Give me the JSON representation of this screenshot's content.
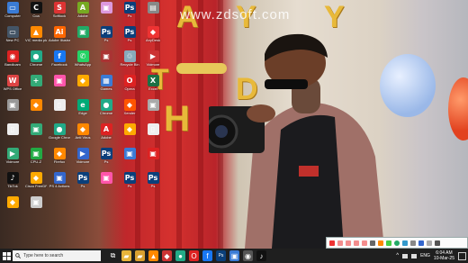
{
  "watermark": "www.zdsoft.com",
  "desktop_icons": [
    {
      "label": "Computer",
      "color": "#3a7bd5",
      "glyph": "▭"
    },
    {
      "label": "Coa",
      "color": "#111",
      "glyph": "C"
    },
    {
      "label": "Softlock",
      "color": "#d33",
      "glyph": "S"
    },
    {
      "label": "Adobe",
      "color": "#7a2",
      "glyph": "A"
    },
    {
      "label": "",
      "color": "#d9d",
      "glyph": "▣"
    },
    {
      "label": "Ps",
      "color": "#0b3f7a",
      "glyph": "Ps"
    },
    {
      "label": "",
      "color": "#888",
      "glyph": "▤"
    },
    {
      "label": "New PC",
      "color": "#456",
      "glyph": "▭"
    },
    {
      "label": "VIC media player",
      "color": "#f80",
      "glyph": "▲"
    },
    {
      "label": "Adobe Illustrator",
      "color": "#f60",
      "glyph": "Ai"
    },
    {
      "label": "",
      "color": "#2a6",
      "glyph": "▣"
    },
    {
      "label": "Ps",
      "color": "#0b3f7a",
      "glyph": "Ps"
    },
    {
      "label": "Ps",
      "color": "#0b3f7a",
      "glyph": "Ps"
    },
    {
      "label": "AnyDesk",
      "color": "#e33",
      "glyph": "◆"
    },
    {
      "label": "Bandicam",
      "color": "#d22",
      "glyph": "◉"
    },
    {
      "label": "Chrome",
      "color": "#2a8",
      "glyph": "●"
    },
    {
      "label": "Facebook",
      "color": "#1877f2",
      "glyph": "f"
    },
    {
      "label": "WhatsApp",
      "color": "#25d366",
      "glyph": "✆"
    },
    {
      "label": "",
      "color": "#a33",
      "glyph": "▣"
    },
    {
      "label": "Recycle Bin",
      "color": "#8ab",
      "glyph": "♲"
    },
    {
      "label": "Vidmore",
      "color": "#c33",
      "glyph": "▶"
    },
    {
      "label": "WPS Office",
      "color": "#d44",
      "glyph": "W"
    },
    {
      "label": "",
      "color": "#3a7",
      "glyph": "+"
    },
    {
      "label": "",
      "color": "#f5a",
      "glyph": "▣"
    },
    {
      "label": "",
      "color": "#fa0",
      "glyph": "◆"
    },
    {
      "label": "Games",
      "color": "#3a7bd5",
      "glyph": "▦"
    },
    {
      "label": "Opera",
      "color": "#d22",
      "glyph": "O"
    },
    {
      "label": "Excel",
      "color": "#1d7044",
      "glyph": "X"
    },
    {
      "label": "",
      "color": "#999",
      "glyph": "▣"
    },
    {
      "label": "",
      "color": "#f80",
      "glyph": "◆"
    },
    {
      "label": "",
      "color": "#eee",
      "glyph": "▯"
    },
    {
      "label": "Edge",
      "color": "#0a7",
      "glyph": "e"
    },
    {
      "label": "Chrome",
      "color": "#2a8",
      "glyph": "●"
    },
    {
      "label": "Xender",
      "color": "#f50",
      "glyph": "◆"
    },
    {
      "label": "",
      "color": "#aaa",
      "glyph": "▣"
    },
    {
      "label": "",
      "color": "#eee",
      "glyph": "▯"
    },
    {
      "label": "",
      "color": "#3a7",
      "glyph": "▣"
    },
    {
      "label": "Google Chrome",
      "color": "#2a8",
      "glyph": "●"
    },
    {
      "label": "Anti Virus",
      "color": "#f80",
      "glyph": "◆"
    },
    {
      "label": "Adobe",
      "color": "#d22",
      "glyph": "A"
    },
    {
      "label": "",
      "color": "#fa0",
      "glyph": "◆"
    },
    {
      "label": "",
      "color": "#eee",
      "glyph": "▯"
    },
    {
      "label": "Vidmore",
      "color": "#3a7",
      "glyph": "▶"
    },
    {
      "label": "CPU-Z",
      "color": "#2a4",
      "glyph": "▣"
    },
    {
      "label": "Firefox",
      "color": "#f80",
      "glyph": "◆"
    },
    {
      "label": "Vidmore",
      "color": "#36c",
      "glyph": "▶"
    },
    {
      "label": "Ps",
      "color": "#0b3f7a",
      "glyph": "Ps"
    },
    {
      "label": "",
      "color": "#3a7bd5",
      "glyph": "▣"
    },
    {
      "label": "",
      "color": "#d22",
      "glyph": "▣"
    },
    {
      "label": "TikTok",
      "color": "#111",
      "glyph": "♪"
    },
    {
      "label": "Cisco FreeDPC",
      "color": "#fa0",
      "glyph": "◆"
    },
    {
      "label": "PS 4 Actions",
      "color": "#36c",
      "glyph": "▣"
    },
    {
      "label": "Ps",
      "color": "#0b3f7a",
      "glyph": "Ps"
    },
    {
      "label": "",
      "color": "#f5a",
      "glyph": "▣"
    },
    {
      "label": "Ps",
      "color": "#0b3f7a",
      "glyph": "Ps"
    },
    {
      "label": "Ps",
      "color": "#0b3f7a",
      "glyph": "Ps"
    },
    {
      "label": "",
      "color": "#fa0",
      "glyph": "◆"
    },
    {
      "label": "",
      "color": "#ccc",
      "glyph": "▣"
    }
  ],
  "taskbar": {
    "search_placeholder": "Type here to search",
    "apps": [
      {
        "name": "task-view-icon",
        "glyph": "⧉",
        "color": "#1f1f1f"
      },
      {
        "name": "file-explorer-icon",
        "glyph": "▰",
        "color": "#e8b43a"
      },
      {
        "name": "folder-icon",
        "glyph": "▰",
        "color": "#d9a030"
      },
      {
        "name": "vlc-icon",
        "glyph": "▲",
        "color": "#f80"
      },
      {
        "name": "app-icon",
        "glyph": "◆",
        "color": "#c33"
      },
      {
        "name": "chrome-icon",
        "glyph": "●",
        "color": "#2a8"
      },
      {
        "name": "opera-icon",
        "glyph": "O",
        "color": "#d22"
      },
      {
        "name": "facebook-icon",
        "glyph": "f",
        "color": "#1877f2"
      },
      {
        "name": "photoshop-icon",
        "glyph": "Ps",
        "color": "#0b3f7a"
      },
      {
        "name": "app2-icon",
        "glyph": "▣",
        "color": "#3a7bd5"
      },
      {
        "name": "app3-icon",
        "glyph": "◉",
        "color": "#555"
      },
      {
        "name": "tiktok-icon",
        "glyph": "♪",
        "color": "#111"
      }
    ],
    "tray_lang": "ENG",
    "clock_time": "6:04 AM",
    "clock_date": "10-Mar-25"
  }
}
